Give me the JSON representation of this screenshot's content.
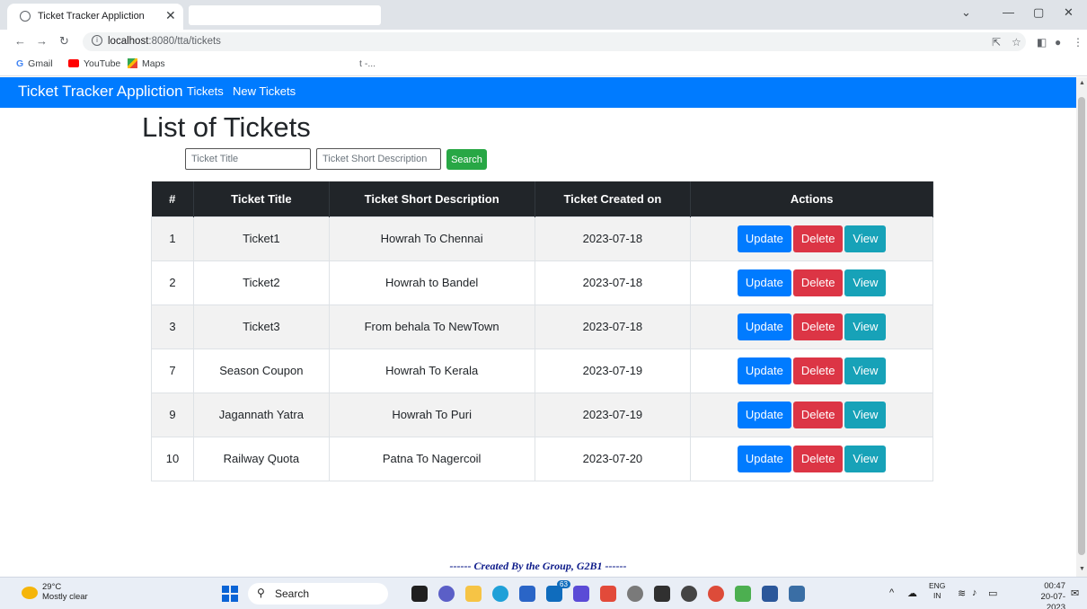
{
  "browser": {
    "tab_title": "Ticket Tracker Appliction",
    "tab_close": "✕",
    "url_host": "localhost",
    "url_path": ":8080/tta/tickets",
    "bookmarks": [
      {
        "label": "Gmail",
        "icon": "gmail-icon"
      },
      {
        "label": "YouTube",
        "icon": "youtube-icon"
      },
      {
        "label": "Maps",
        "icon": "maps-icon"
      }
    ],
    "bookmark_extra": "t -..."
  },
  "app": {
    "brand": "Ticket Tracker Appliction",
    "nav": [
      "Tickets",
      "New Tickets"
    ],
    "page_title": "List of Tickets",
    "search": {
      "title_placeholder": "Ticket Title",
      "desc_placeholder": "Ticket Short Description",
      "button": "Search"
    },
    "table": {
      "headers": [
        "#",
        "Ticket Title",
        "Ticket Short Description",
        "Ticket Created on",
        "Actions"
      ],
      "rows": [
        {
          "id": "1",
          "title": "Ticket1",
          "desc": "Howrah To Chennai",
          "created": "2023-07-18"
        },
        {
          "id": "2",
          "title": "Ticket2",
          "desc": "Howrah to Bandel",
          "created": "2023-07-18"
        },
        {
          "id": "3",
          "title": "Ticket3",
          "desc": "From behala To NewTown",
          "created": "2023-07-18"
        },
        {
          "id": "7",
          "title": "Season Coupon",
          "desc": "Howrah To Kerala",
          "created": "2023-07-19"
        },
        {
          "id": "9",
          "title": "Jagannath Yatra",
          "desc": "Howrah To Puri",
          "created": "2023-07-19"
        },
        {
          "id": "10",
          "title": "Railway Quota",
          "desc": "Patna To Nagercoil",
          "created": "2023-07-20"
        }
      ],
      "actions": {
        "update": "Update",
        "delete": "Delete",
        "view": "View"
      }
    },
    "footer": "------ Created By the Group, G2B1 ------",
    "colors": {
      "navbar": "#007bff",
      "update": "#007bff",
      "delete": "#dc3545",
      "view": "#17a2b8",
      "search": "#28a745",
      "header": "#212529"
    }
  },
  "taskbar": {
    "temperature": "29°C",
    "weather": "Mostly clear",
    "search_label": "Search",
    "lang_top": "ENG",
    "lang_bottom": "IN",
    "time": "00:47",
    "date": "20-07-2023",
    "badge": "63"
  }
}
